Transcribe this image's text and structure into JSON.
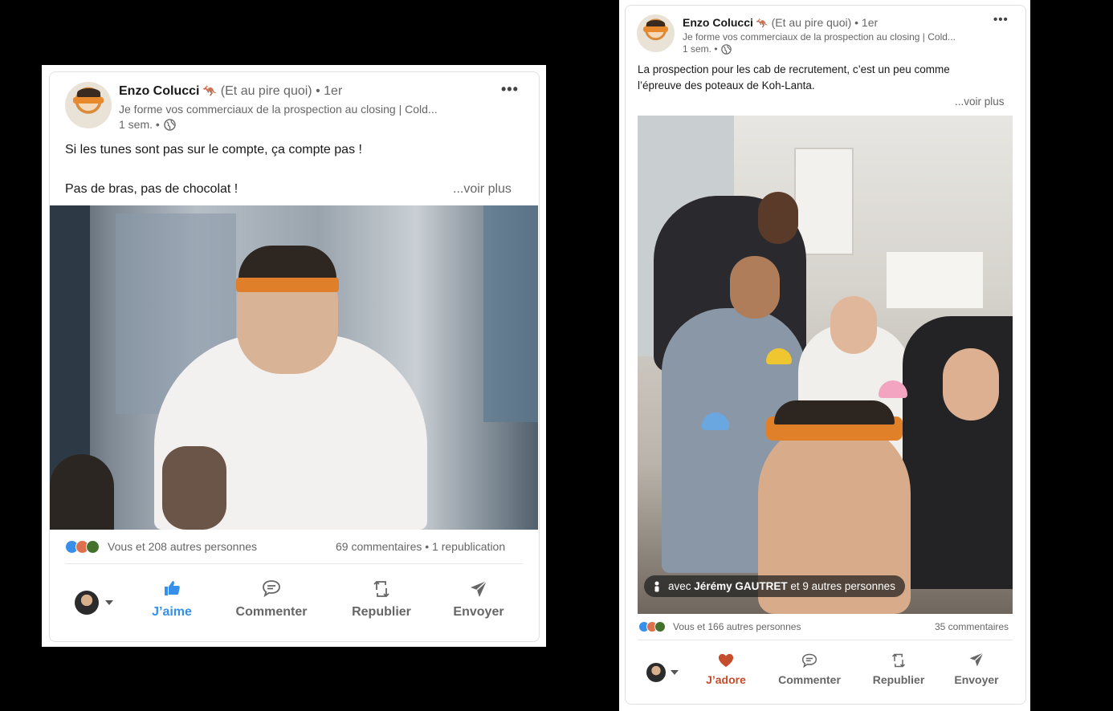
{
  "post1": {
    "author_name": "Enzo Colucci",
    "author_emoji": "🦘",
    "author_suffix": "(Et au pire quoi)",
    "degree": "• 1er",
    "headline": "Je forme vos commerciaux de la prospection au closing | Cold...",
    "time": "1 sem. •",
    "text_line1": "Si les tunes sont pas sur le compte, ça compte pas !",
    "text_line2": "Pas de bras, pas de chocolat !",
    "see_more": "...voir plus",
    "reactions_text": "Vous et 208 autres personnes",
    "comments_text": "69 commentaires • 1 republication",
    "actions": {
      "like": "J’aime",
      "comment": "Commenter",
      "repost": "Republier",
      "send": "Envoyer"
    },
    "colors": {
      "like_active": "#378fe9"
    }
  },
  "post2": {
    "author_name": "Enzo Colucci",
    "author_emoji": "🦘",
    "author_suffix": "(Et au pire quoi)",
    "degree": "• 1er",
    "headline": "Je forme vos commerciaux de la prospection au closing | Cold...",
    "time": "1 sem. •",
    "text_line1": "La prospection pour les cab de recrutement, c’est un peu comme",
    "text_line2": "l’épreuve des poteaux de Koh-Lanta.",
    "see_more": "...voir plus",
    "tag_prefix": "avec",
    "tag_person": "Jérémy GAUTRET",
    "tag_suffix": "et 9 autres personnes",
    "reactions_text": "Vous et 166 autres personnes",
    "comments_text": "35 commentaires",
    "actions": {
      "love": "J’adore",
      "comment": "Commenter",
      "repost": "Republier",
      "send": "Envoyer"
    },
    "colors": {
      "love_active": "#c44d2c"
    }
  }
}
